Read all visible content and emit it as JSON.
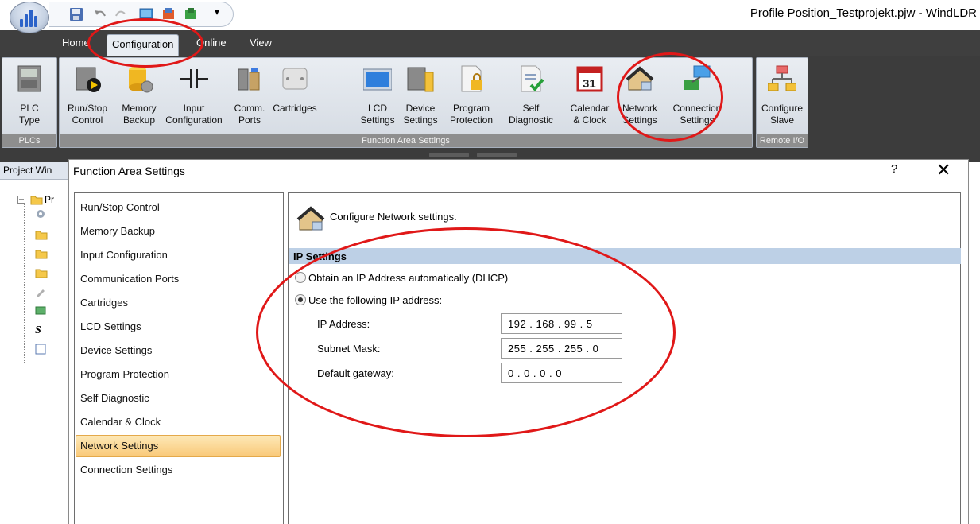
{
  "window": {
    "title": "Profile Position_Testprojekt.pjw - WindLDR"
  },
  "menu_tabs": [
    {
      "label": "Home",
      "active": false
    },
    {
      "label": "Configuration",
      "active": true
    },
    {
      "label": "Online",
      "active": false
    },
    {
      "label": "View",
      "active": false
    }
  ],
  "ribbon": {
    "groups": [
      {
        "label": "PLCs"
      },
      {
        "label": "Function Area Settings"
      },
      {
        "label": "Remote I/O"
      }
    ],
    "buttons": [
      {
        "label": "PLC\nType",
        "icon": "plc-type-icon"
      },
      {
        "label": "Run/Stop\nControl",
        "icon": "run-stop-icon"
      },
      {
        "label": "Memory\nBackup",
        "icon": "memory-backup-icon"
      },
      {
        "label": "Input\nConfiguration",
        "icon": "input-configuration-icon"
      },
      {
        "label": "Comm.\nPorts",
        "icon": "comm-ports-icon"
      },
      {
        "label": "Cartridges",
        "icon": "cartridges-icon"
      },
      {
        "label": "LCD\nSettings",
        "icon": "lcd-icon"
      },
      {
        "label": "Device\nSettings",
        "icon": "device-settings-icon"
      },
      {
        "label": "Program\nProtection",
        "icon": "lock-icon"
      },
      {
        "label": "Self\nDiagnostic",
        "icon": "checklist-icon"
      },
      {
        "label": "Calendar\n& Clock",
        "icon": "calendar-icon"
      },
      {
        "label": "Network\nSettings",
        "icon": "house-network-icon"
      },
      {
        "label": "Connection\nSettings",
        "icon": "connection-icon"
      },
      {
        "label": "Configure\nSlave",
        "icon": "hierarchy-icon"
      }
    ]
  },
  "project_window": {
    "title": "Project Win",
    "root_label": "Pr"
  },
  "dialog": {
    "title": "Function Area Settings",
    "help": "?",
    "close": "✕",
    "nav_items": [
      "Run/Stop Control",
      "Memory Backup",
      "Input Configuration",
      "Communication Ports",
      "Cartridges",
      "LCD Settings",
      "Device Settings",
      "Program Protection",
      "Self Diagnostic",
      "Calendar & Clock",
      "Network Settings",
      "Connection Settings"
    ],
    "selected_nav": "Network Settings",
    "content": {
      "header": "Configure Network settings.",
      "section": "IP Settings",
      "radio_dhcp": "Obtain an IP Address automatically (DHCP)",
      "radio_static": "Use the following IP address:",
      "static_selected": true,
      "fields": [
        {
          "label": "IP Address:",
          "value": "192 . 168 . 99 . 5"
        },
        {
          "label": "Subnet Mask:",
          "value": "255 . 255 . 255 . 0"
        },
        {
          "label": "Default gateway:",
          "value": "0 . 0 . 0 . 0"
        }
      ]
    }
  },
  "colors": {
    "annotation": "#e01818",
    "selection": "#f9c979",
    "section_header": "#bdd0e6"
  }
}
